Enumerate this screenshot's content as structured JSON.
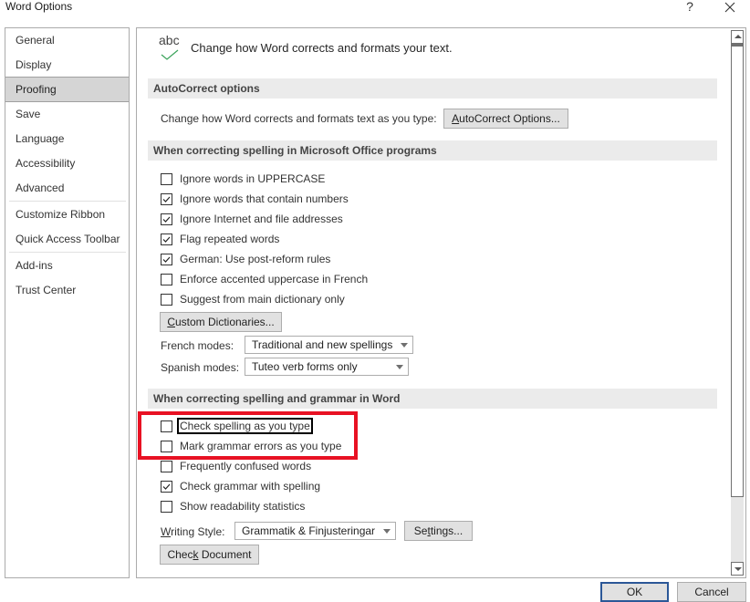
{
  "window": {
    "title": "Word Options",
    "help_label": "?",
    "close_label": "✕"
  },
  "nav": {
    "items": [
      {
        "label": "General"
      },
      {
        "label": "Display"
      },
      {
        "label": "Proofing",
        "active": true
      },
      {
        "label": "Save"
      },
      {
        "label": "Language"
      },
      {
        "label": "Accessibility"
      },
      {
        "label": "Advanced"
      },
      {
        "label": "Customize Ribbon"
      },
      {
        "label": "Quick Access Toolbar"
      },
      {
        "label": "Add-ins"
      },
      {
        "label": "Trust Center"
      }
    ]
  },
  "header": {
    "icon": "abc-checkmark-icon",
    "icon_text": "abc",
    "text": "Change how Word corrects and formats your text."
  },
  "autocorrect": {
    "section_title": "AutoCorrect options",
    "description": "Change how Word corrects and formats text as you type:",
    "button_label": "AutoCorrect Options...",
    "button_access_key": "A"
  },
  "office_spelling": {
    "section_title": "When correcting spelling in Microsoft Office programs",
    "options": [
      {
        "label": "Ignore words in UPPERCASE",
        "checked": false
      },
      {
        "label": "Ignore words that contain numbers",
        "checked": true
      },
      {
        "label": "Ignore Internet and file addresses",
        "checked": true
      },
      {
        "label": "Flag repeated words",
        "checked": true
      },
      {
        "label": "German: Use post-reform rules",
        "checked": true
      },
      {
        "label": "Enforce accented uppercase in French",
        "checked": false
      },
      {
        "label": "Suggest from main dictionary only",
        "checked": false
      }
    ],
    "custom_dictionaries_label": "Custom Dictionaries...",
    "french_modes_label": "French modes:",
    "french_modes_value": "Traditional and new spellings",
    "spanish_modes_label": "Spanish modes:",
    "spanish_modes_value": "Tuteo verb forms only"
  },
  "word_spelling": {
    "section_title": "When correcting spelling and grammar in Word",
    "options": [
      {
        "label": "Check spelling as you type",
        "checked": false,
        "focused": true
      },
      {
        "label": "Mark grammar errors as you type",
        "checked": false
      },
      {
        "label": "Frequently confused words",
        "checked": false
      },
      {
        "label": "Check grammar with spelling",
        "checked": true
      },
      {
        "label": "Show readability statistics",
        "checked": false
      }
    ],
    "writing_style_label": "Writing Style:",
    "writing_style_value": "Grammatik & Finjusteringar",
    "settings_label": "Settings...",
    "check_document_label": "Check Document"
  },
  "annotation": {
    "highlight_color": "#e81123"
  },
  "footer": {
    "ok_label": "OK",
    "cancel_label": "Cancel"
  },
  "colors": {
    "check_green": "#3aa35a",
    "section_bg": "#ebebeb",
    "nav_active_bg": "#d5d5d5",
    "ok_border": "#2b5797"
  }
}
